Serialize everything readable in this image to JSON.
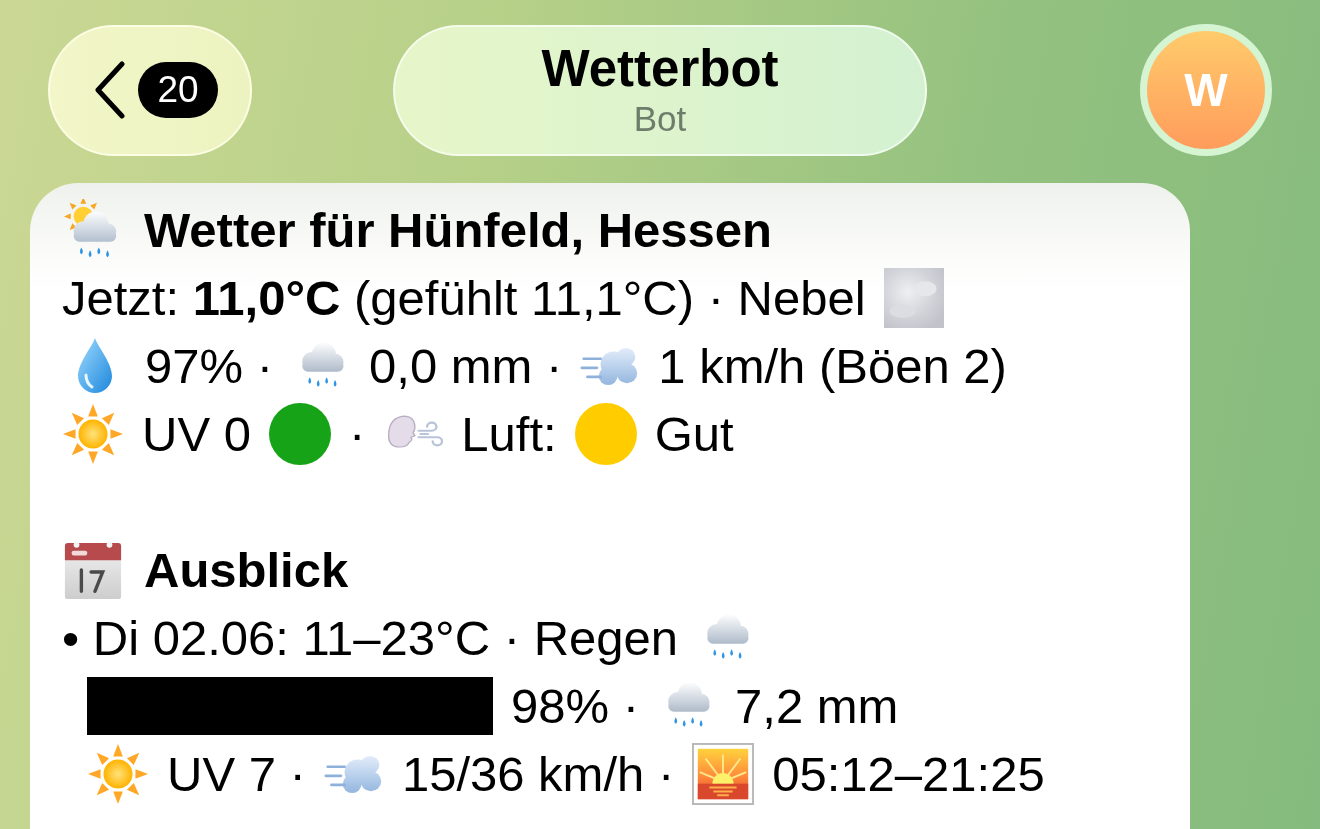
{
  "header": {
    "back_badge": "20",
    "title": "Wetterbot",
    "subtitle": "Bot",
    "avatar_letter": "W"
  },
  "message": {
    "title": "Wetter für Hünfeld, Hessen",
    "now": "Jetzt: **11,0°C** (gefühlt 11,1°C) · Nebel",
    "humidity": "97% ·",
    "precipitation": "0,0 mm ·",
    "wind": "1 km/h (Böen 2)",
    "uv": {
      "label": "UV 0",
      "color": "#17a317"
    },
    "uv_separator": "·",
    "air": {
      "label": "Luft:",
      "color": "#ffcc00",
      "value": "Gut"
    },
    "outlook_title": "Ausblick",
    "days": [
      {
        "kind": "rain",
        "summary": "• Di 02.06: 11–23°C · Regen",
        "redacted": true,
        "chance": "98% ·",
        "amount": "7,2 mm",
        "uv": "UV 7 ·",
        "wind": "15/36 km/h ·",
        "daylight": "05:12–21:25"
      }
    ]
  }
}
